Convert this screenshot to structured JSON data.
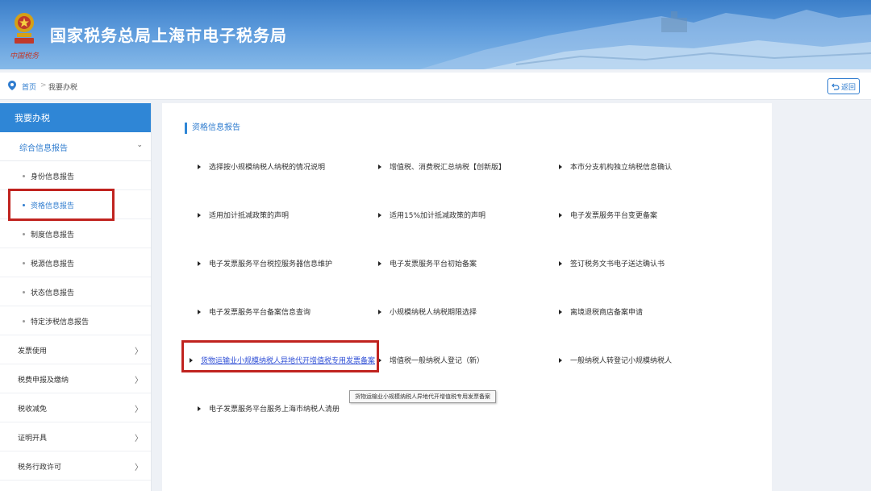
{
  "header": {
    "site_title": "国家税务总局上海市电子税务局",
    "emblem_caption": "中国税务"
  },
  "breadcrumb": {
    "home": "首页",
    "separator": ">",
    "current": "我要办税"
  },
  "back_button": {
    "label": "返回",
    "icon": "back-arrow-icon"
  },
  "sidebar": {
    "head": "我要办税",
    "group": {
      "label": "综合信息报告",
      "chevron": "⌄"
    },
    "subs": [
      {
        "label": "身份信息报告"
      },
      {
        "label": "资格信息报告"
      },
      {
        "label": "制度信息报告"
      },
      {
        "label": "税源信息报告"
      },
      {
        "label": "状态信息报告"
      },
      {
        "label": "特定涉税信息报告"
      }
    ],
    "items": [
      {
        "label": "发票使用",
        "chevron": "〉"
      },
      {
        "label": "税费申报及缴纳",
        "chevron": "〉"
      },
      {
        "label": "税收减免",
        "chevron": "〉"
      },
      {
        "label": "证明开具",
        "chevron": "〉"
      },
      {
        "label": "税务行政许可",
        "chevron": "〉"
      }
    ]
  },
  "main": {
    "section_title": "资格信息报告",
    "items": [
      {
        "label": "选择按小规模纳税人纳税的情况说明"
      },
      {
        "label": "增值税、消费税汇总纳税【创新版】"
      },
      {
        "label": "本市分支机构独立纳税信息确认"
      },
      {
        "label": "适用加计抵减政策的声明"
      },
      {
        "label": "适用15%加计抵减政策的声明"
      },
      {
        "label": "电子发票服务平台变更备案"
      },
      {
        "label": "电子发票服务平台税控服务器信息维护"
      },
      {
        "label": "电子发票服务平台初始备案"
      },
      {
        "label": "签订税务文书电子送达确认书"
      },
      {
        "label": "电子发票服务平台备案信息查询"
      },
      {
        "label": "小规模纳税人纳税期限选择"
      },
      {
        "label": "离境退税商店备案申请"
      },
      {
        "label": "货物运输业小规模纳税人异地代开增值税专用发票备案"
      },
      {
        "label": "增值税一般纳税人登记（新）"
      },
      {
        "label": "一般纳税人转登记小规模纳税人"
      },
      {
        "label": "电子发票服务平台服务上海市纳税人清册"
      }
    ],
    "tooltip": "货物运输业小规模纳税人异地代开增值税专用发票备案"
  },
  "colors": {
    "header_blue": "#3c7fc9",
    "accent_blue": "#2f86d6",
    "link_blue": "#2f7ccf",
    "highlight_red": "#c0231f"
  }
}
